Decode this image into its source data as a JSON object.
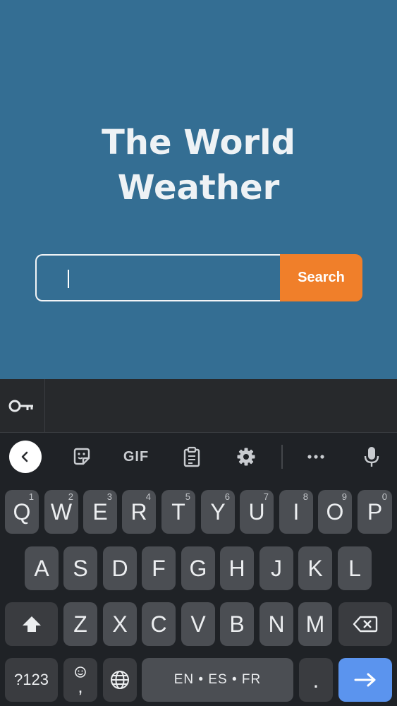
{
  "app": {
    "title": "The World\nWeather",
    "search_input": {
      "value": "",
      "placeholder": ""
    },
    "search_button_label": "Search"
  },
  "keyboard": {
    "row1": [
      {
        "key": "Q",
        "hint": "1"
      },
      {
        "key": "W",
        "hint": "2"
      },
      {
        "key": "E",
        "hint": "3"
      },
      {
        "key": "R",
        "hint": "4"
      },
      {
        "key": "T",
        "hint": "5"
      },
      {
        "key": "Y",
        "hint": "6"
      },
      {
        "key": "U",
        "hint": "7"
      },
      {
        "key": "I",
        "hint": "8"
      },
      {
        "key": "O",
        "hint": "9"
      },
      {
        "key": "P",
        "hint": "0"
      }
    ],
    "row2": [
      "A",
      "S",
      "D",
      "F",
      "G",
      "H",
      "J",
      "K",
      "L"
    ],
    "row3": [
      "Z",
      "X",
      "C",
      "V",
      "B",
      "N",
      "M"
    ],
    "symbols_label": "?123",
    "comma_label": ",",
    "space_label": "EN • ES • FR",
    "period_label": ".",
    "gif_label": "GIF",
    "toolbar_icons": [
      "back-icon",
      "sticker-icon",
      "gif-icon",
      "clipboard-icon",
      "settings-icon",
      "more-icon",
      "microphone-icon"
    ],
    "colors": {
      "enter_key": "#5b94ee",
      "search_button": "#f07f2a",
      "background": "#346e93"
    }
  }
}
